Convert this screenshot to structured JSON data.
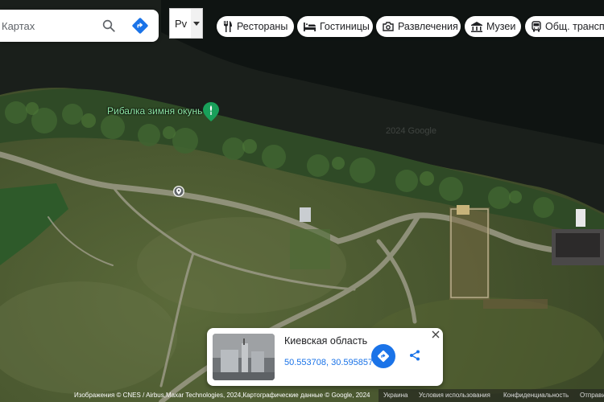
{
  "search": {
    "placeholder": "Картах"
  },
  "language": {
    "value": "Рv"
  },
  "chips": [
    {
      "label": "Рестораны",
      "icon": "fork-knife-icon"
    },
    {
      "label": "Гостиницы",
      "icon": "bed-icon"
    },
    {
      "label": "Развлечения",
      "icon": "camera-icon"
    },
    {
      "label": "Музеи",
      "icon": "museum-icon"
    },
    {
      "label": "Общ. транспорт",
      "icon": "bus-icon"
    }
  ],
  "map": {
    "place_label": "Рибалка зимня окунь",
    "watermark": "2024 Google"
  },
  "info_card": {
    "title": "Киевская область",
    "coordinates": "50.553708, 30.595857"
  },
  "footer": {
    "attribution": "Изображения © CNES / Airbus,Maxar Technologies, 2024,Картографические данные © Google, 2024",
    "country": "Украина",
    "terms": "Условия использования",
    "privacy": "Конфиденциальность",
    "feedback": "Отправить"
  },
  "colors": {
    "accent": "#1a73e8",
    "place_pin": "#19a05a"
  }
}
